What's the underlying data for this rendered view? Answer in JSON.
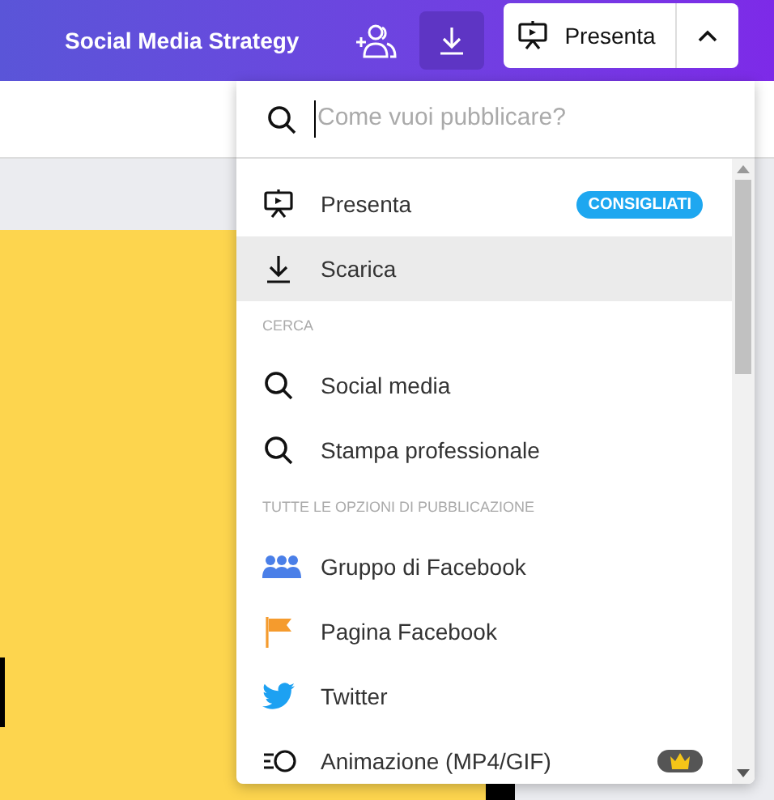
{
  "header": {
    "title": "Social Media Strategy",
    "present_button": "Presenta",
    "download_active": true
  },
  "menu": {
    "search": {
      "placeholder": "Come vuoi pubblicare?"
    },
    "sections": [
      {
        "items": [
          {
            "kind": "present",
            "label": "Presenta",
            "badge": "CONSIGLIATI",
            "selected": false
          },
          {
            "kind": "download",
            "label": "Scarica",
            "selected": true
          }
        ]
      },
      {
        "heading": "CERCA",
        "items": [
          {
            "kind": "search",
            "label": "Social media",
            "selected": false
          },
          {
            "kind": "search",
            "label": "Stampa professionale",
            "selected": false
          }
        ]
      },
      {
        "heading": "TUTTE LE OPZIONI DI PUBBLICAZIONE",
        "items": [
          {
            "kind": "group",
            "label": "Gruppo di Facebook",
            "selected": false
          },
          {
            "kind": "flag",
            "label": "Pagina Facebook",
            "selected": false
          },
          {
            "kind": "bird",
            "label": "Twitter",
            "selected": false
          },
          {
            "kind": "animation",
            "label": "Animazione (MP4/GIF)",
            "premium": true,
            "selected": false
          }
        ]
      }
    ]
  }
}
